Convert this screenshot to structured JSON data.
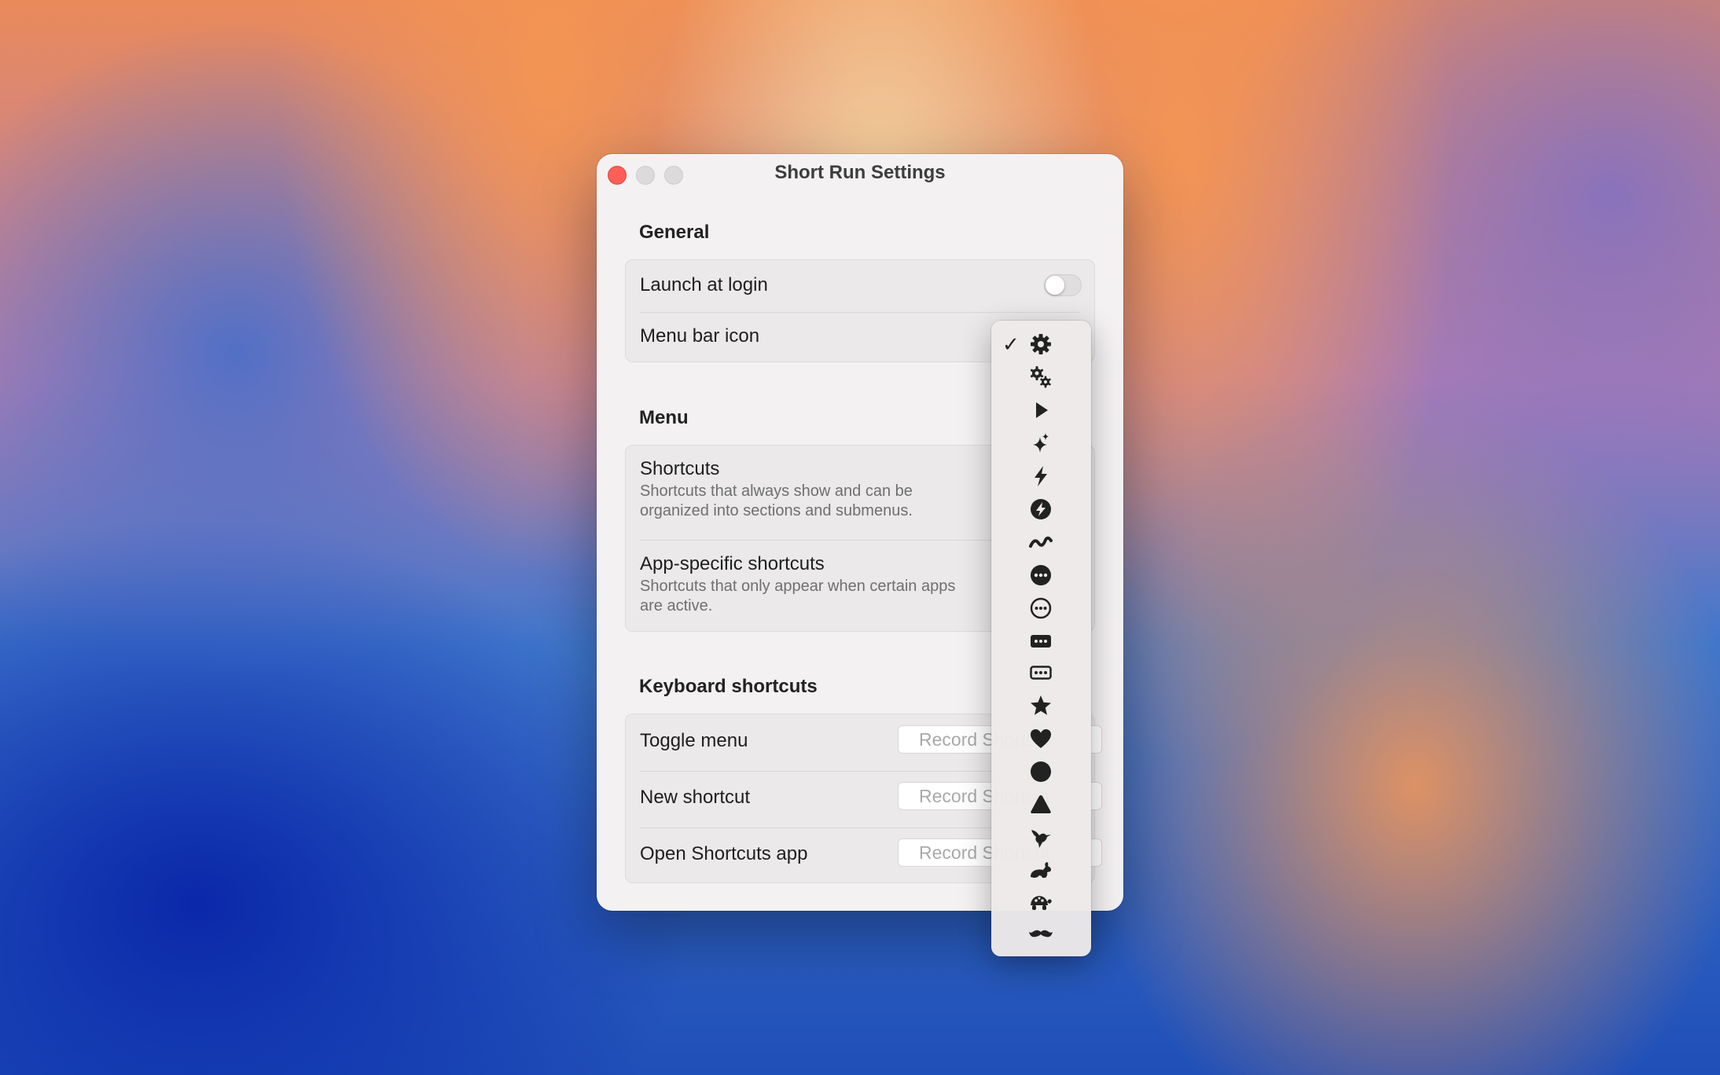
{
  "window": {
    "title": "Short Run Settings"
  },
  "general": {
    "title": "General",
    "launch_at_login": "Launch at login",
    "menu_bar_icon": "Menu bar icon"
  },
  "menu": {
    "title": "Menu",
    "shortcuts_title": "Shortcuts",
    "shortcuts_sub": "Shortcuts that always show and can be organized into sections and submenus.",
    "app_title": "App-specific shortcuts",
    "app_sub": "Shortcuts that only appear when certain apps are active."
  },
  "keyboard": {
    "title": "Keyboard shortcuts",
    "rows": [
      {
        "label": "Toggle menu",
        "placeholder": "Record Shortcut"
      },
      {
        "label": "New shortcut",
        "placeholder": "Record Shortcut"
      },
      {
        "label": "Open Shortcuts app",
        "placeholder": "Record Shortcut"
      }
    ]
  },
  "icon_menu": {
    "check": "✓",
    "selected": "gear-icon",
    "items": [
      "gear-icon",
      "gears-icon",
      "play-icon",
      "sparkles-icon",
      "bolt-icon",
      "bolt-circle-icon",
      "squiggle-icon",
      "ellipsis-circle-fill-icon",
      "ellipsis-circle-icon",
      "ellipsis-rect-fill-icon",
      "ellipsis-rect-icon",
      "star-icon",
      "heart-icon",
      "circle-icon",
      "triangle-icon",
      "bird-icon",
      "hare-icon",
      "tortoise-icon",
      "mustache-icon"
    ]
  }
}
